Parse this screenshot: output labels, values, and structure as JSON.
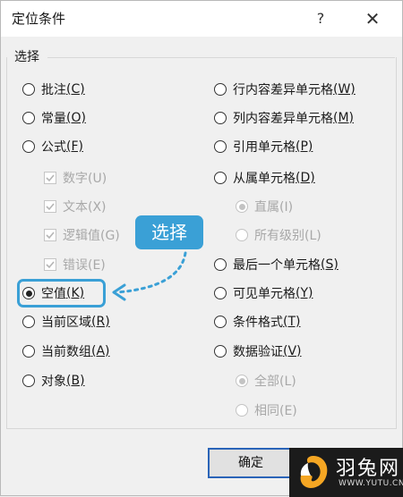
{
  "dialog": {
    "title": "定位条件",
    "help_label": "?",
    "close_label": "✕"
  },
  "group": {
    "title": "选择"
  },
  "options": {
    "comments": {
      "label": "批注",
      "key": "(C)"
    },
    "constants": {
      "label": "常量",
      "key": "(O)"
    },
    "formulas": {
      "label": "公式",
      "key": "(F)"
    },
    "numbers": {
      "label": "数字(U)"
    },
    "text": {
      "label": "文本(X)"
    },
    "logicals": {
      "label": "逻辑值(G)"
    },
    "errors": {
      "label": "错误(E)"
    },
    "blanks": {
      "label": "空值",
      "key": "(K)"
    },
    "current_region": {
      "label": "当前区域",
      "key": "(R)"
    },
    "current_array": {
      "label": "当前数组",
      "key": "(A)"
    },
    "objects": {
      "label": "对象",
      "key": "(B)"
    },
    "row_differences": {
      "label": "行内容差异单元格",
      "key": "(W)"
    },
    "column_differences": {
      "label": "列内容差异单元格",
      "key": "(M)"
    },
    "precedents": {
      "label": "引用单元格",
      "key": "(P)"
    },
    "dependents": {
      "label": "从属单元格",
      "key": "(D)"
    },
    "direct_only": {
      "label": "直属(I)"
    },
    "all_levels": {
      "label": "所有级别(L)"
    },
    "last_cell": {
      "label": "最后一个单元格",
      "key": "(S)"
    },
    "visible_cells": {
      "label": "可见单元格",
      "key": "(Y)"
    },
    "conditional_formats": {
      "label": "条件格式",
      "key": "(T)"
    },
    "data_validation": {
      "label": "数据验证",
      "key": "(V)"
    },
    "all": {
      "label": "全部(L)"
    },
    "same": {
      "label": "相同(E)"
    }
  },
  "annotation": {
    "callout_text": "选择",
    "accent_color": "#3aa0d6"
  },
  "buttons": {
    "ok_label": "确定"
  },
  "watermark": {
    "name": "羽兔网",
    "url": "WWW.YUTU.CN"
  }
}
